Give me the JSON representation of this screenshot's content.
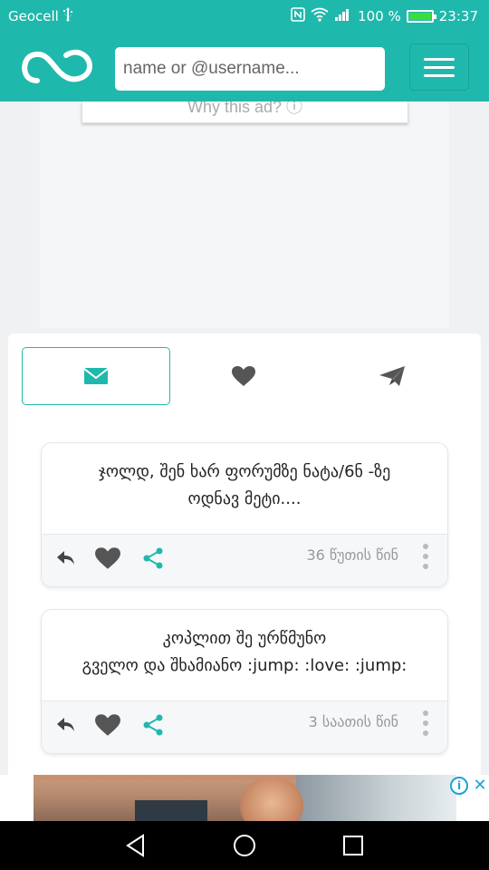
{
  "status_bar": {
    "carrier": "Geocell",
    "usb_icon": "usb-icon",
    "nfc_icon": "nfc-icon",
    "wifi_icon": "wifi-icon",
    "signal_icon": "signal-icon",
    "battery_percent": "100 %",
    "battery_level": 1.0,
    "time": "23:37"
  },
  "header": {
    "logo_icon": "infinity-logo-icon",
    "search_placeholder": "name or @username...",
    "search_value": "",
    "menu_icon": "hamburger-menu-icon"
  },
  "ad": {
    "why_label": "Why this ad? ⓘ"
  },
  "tabs": [
    {
      "icon": "envelope-icon",
      "active": true
    },
    {
      "icon": "heart-icon",
      "active": false
    },
    {
      "icon": "paper-plane-icon",
      "active": false
    }
  ],
  "messages": [
    {
      "text_line1": "ჯოლდ, შენ ხარ ფორუმზე ნატა/6ნ -ზე",
      "text_line2": "ოდნავ მეტი....",
      "time": "36 წუთის წინ"
    },
    {
      "text_line1": "კოპლით შე ურწმუნო",
      "text_line2": "გველო და შხამიანო :jump: :love: :jump:",
      "time": "3 საათის წინ"
    }
  ],
  "bottom_ad": {
    "info_label": "i",
    "close_label": "✕"
  },
  "colors": {
    "brand": "#1fb8ac",
    "icon_gray": "#555555",
    "muted": "#999999"
  }
}
